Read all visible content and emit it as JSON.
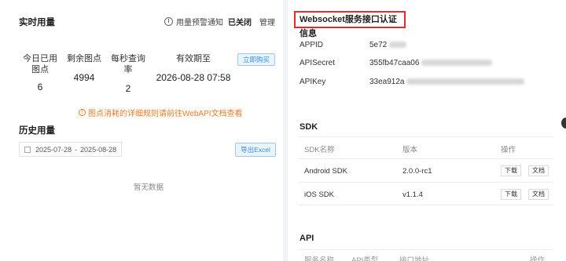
{
  "usage": {
    "title": "实时用量",
    "notify_label": "用量预警通知",
    "notify_state": "已关闭",
    "manage_label": "管理",
    "stats": [
      {
        "label": "今日已用图点",
        "value": "6"
      },
      {
        "label": "剩余图点",
        "value": "4994"
      },
      {
        "label": "每秒查询率",
        "value": "2"
      },
      {
        "label": "有效期至",
        "value": "2026-08-28 07:58"
      }
    ],
    "buy_label": "立即购买",
    "tip_text": "图点消耗的详细规则请前往WebAPI文档查看"
  },
  "history": {
    "title": "历史用量",
    "date_start": "2025-07-28",
    "date_sep": "-",
    "date_end": "2025-08-28",
    "export_label": "导出Excel",
    "empty_text": "暂无数据"
  },
  "websocket": {
    "title": "Websocket服务接口认证信息",
    "creds": [
      {
        "key": "APPID",
        "value": "5e72"
      },
      {
        "key": "APISecret",
        "value": "355fb47caa06"
      },
      {
        "key": "APIKey",
        "value": "33ea912a"
      }
    ]
  },
  "sdk": {
    "title": "SDK",
    "headers": [
      "SDK名称",
      "版本",
      "操作"
    ],
    "rows": [
      {
        "name": "Android SDK",
        "version": "2.0.0-rc1",
        "download": "下载",
        "docs": "文档"
      },
      {
        "name": "iOS SDK",
        "version": "v1.1.4",
        "download": "下载",
        "docs": "文档"
      }
    ]
  },
  "api": {
    "title": "API",
    "headers": [
      "服务名称",
      "API类型",
      "接口地址",
      "操作"
    ]
  },
  "colors": {
    "accent": "#3b8ddf",
    "warning": "#f07c2b",
    "highlight_border": "#e02d2d"
  }
}
